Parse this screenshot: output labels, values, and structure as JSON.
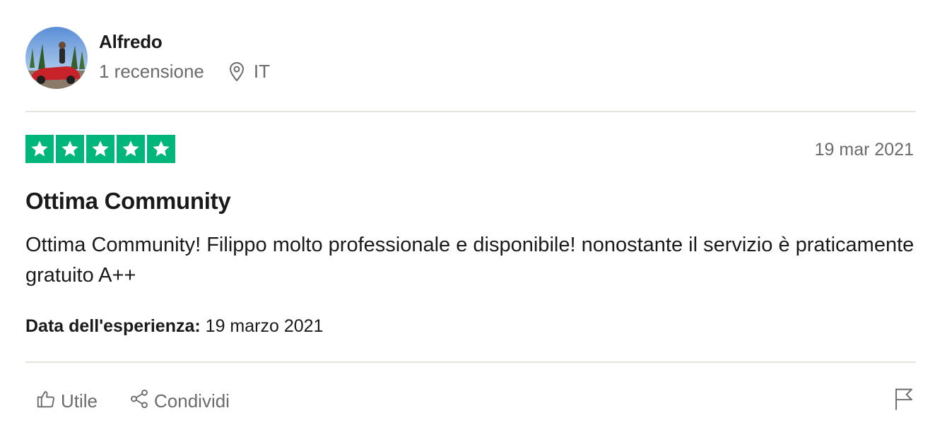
{
  "reviewer": {
    "name": "Alfredo",
    "reviews_count": "1 recensione",
    "location_icon": "location-pin-icon",
    "country": "IT"
  },
  "review": {
    "rating": 5,
    "max_rating": 5,
    "star_color": "#00b67a",
    "date": "19 mar 2021",
    "title": "Ottima Community",
    "body": "Ottima Community! Filippo molto professionale e disponibile! nonostante il servizio è praticamente gratuito A++",
    "experience_label": "Data dell'esperienza:",
    "experience_date": "19 marzo 2021"
  },
  "actions": {
    "useful_label": "Utile",
    "useful_icon": "thumbs-up-icon",
    "share_label": "Condividi",
    "share_icon": "share-icon",
    "report_icon": "flag-icon"
  }
}
